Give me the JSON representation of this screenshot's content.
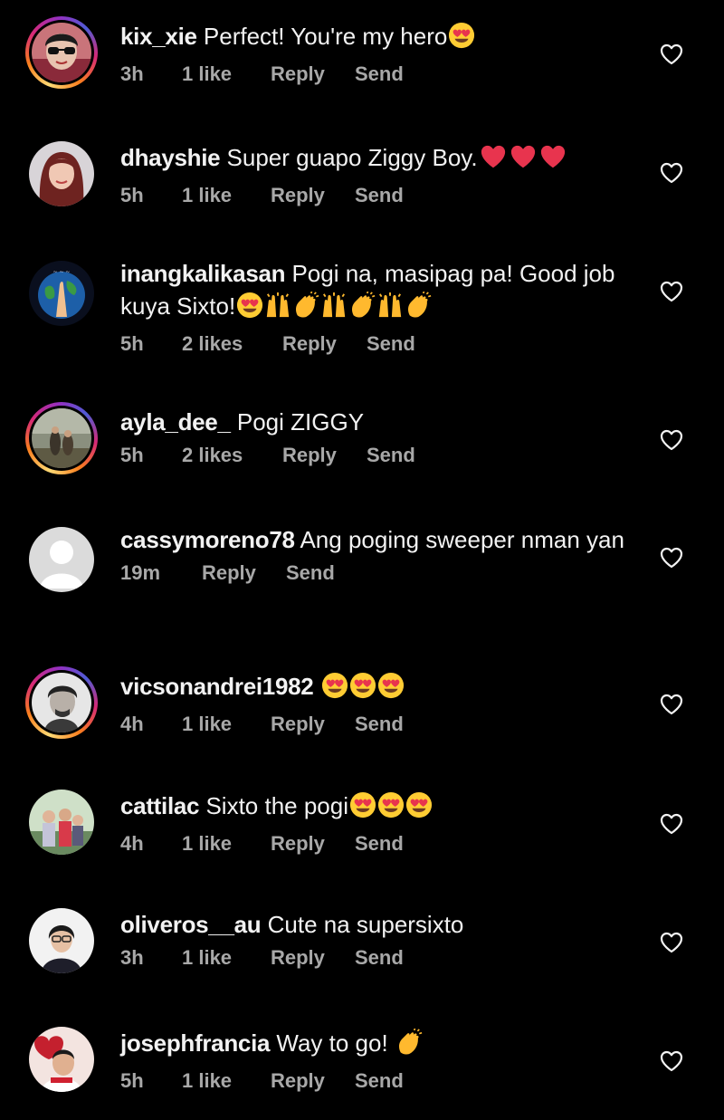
{
  "comments": [
    {
      "username": "kix_xie",
      "text": "Perfect! You're my hero",
      "emojis": [
        "heart-eyes"
      ],
      "time": "3h",
      "likes": "1 like",
      "reply": "Reply",
      "send": "Send",
      "ring": true,
      "avatar": "person-sunglasses"
    },
    {
      "username": "dhayshie",
      "text": "Super guapo Ziggy Boy.",
      "emojis": [
        "red-heart",
        "red-heart",
        "red-heart"
      ],
      "time": "5h",
      "likes": "1 like",
      "reply": "Reply",
      "send": "Send",
      "ring": false,
      "avatar": "person-red-hair"
    },
    {
      "username": "inangkalikasan",
      "text": "Pogi na, masipag pa! Good job kuya Sixto!",
      "emojis": [
        "heart-eyes",
        "raising-hands",
        "clapping-hands",
        "raising-hands",
        "clapping-hands",
        "raising-hands",
        "clapping-hands"
      ],
      "time": "5h",
      "likes": "2 likes",
      "reply": "Reply",
      "send": "Send",
      "ring": false,
      "avatar": "earth-hands"
    },
    {
      "username": "ayla_dee_",
      "text": "Pogi ZIGGY",
      "emojis": [],
      "time": "5h",
      "likes": "2 likes",
      "reply": "Reply",
      "send": "Send",
      "ring": true,
      "avatar": "landscape-people"
    },
    {
      "username": "cassymoreno78",
      "text": "Ang poging sweeper nman yan",
      "emojis": [],
      "time": "19m",
      "likes": "",
      "reply": "Reply",
      "send": "Send",
      "ring": false,
      "avatar": "default-silhouette"
    },
    {
      "username": "vicsonandrei1982",
      "text": "",
      "emojis": [
        "heart-eyes",
        "heart-eyes",
        "heart-eyes"
      ],
      "time": "4h",
      "likes": "1 like",
      "reply": "Reply",
      "send": "Send",
      "ring": true,
      "avatar": "person-bw"
    },
    {
      "username": "cattilac",
      "text": "Sixto the pogi",
      "emojis": [
        "heart-eyes",
        "heart-eyes",
        "heart-eyes"
      ],
      "time": "4h",
      "likes": "1 like",
      "reply": "Reply",
      "send": "Send",
      "ring": false,
      "avatar": "family-photo"
    },
    {
      "username": "oliveros__au",
      "text": "Cute na supersixto",
      "emojis": [],
      "time": "3h",
      "likes": "1 like",
      "reply": "Reply",
      "send": "Send",
      "ring": false,
      "avatar": "person-glasses"
    },
    {
      "username": "josephfrancia",
      "text": "Way to go!",
      "emojis": [
        "clapping-hands"
      ],
      "time": "5h",
      "likes": "1 like",
      "reply": "Reply",
      "send": "Send",
      "ring": false,
      "avatar": "person-heart-bg"
    }
  ],
  "icons": {
    "like": "heart-outline-icon",
    "ring_gradient": [
      "#feda75",
      "#fa7e1e",
      "#d62976",
      "#962fbf",
      "#4f5bd5"
    ]
  },
  "colors": {
    "background": "#000000",
    "text": "#f2f2f2",
    "meta": "#a8a8a8"
  }
}
